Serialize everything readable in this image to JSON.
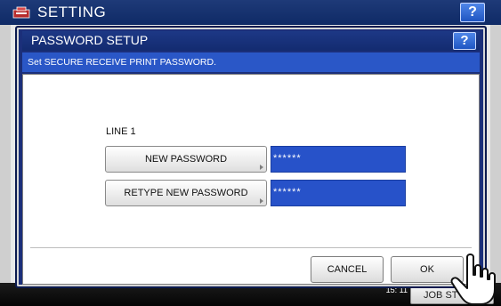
{
  "app": {
    "title": "SETTING",
    "help_label": "?"
  },
  "dialog": {
    "title": "PASSWORD SETUP",
    "help_label": "?",
    "message": "Set SECURE RECEIVE PRINT PASSWORD.",
    "line_label": "LINE 1",
    "new_password": {
      "label": "NEW PASSWORD",
      "value": "******"
    },
    "retype_password": {
      "label": "RETYPE NEW PASSWORD",
      "value": "******"
    },
    "cancel_label": "CANCEL",
    "ok_label": "OK"
  },
  "footer": {
    "time": "15: 11",
    "job_status_label": "JOB ST"
  },
  "colors": {
    "header_blue": "#1e3a78",
    "message_bar_blue": "#2a57c7",
    "value_field_blue": "#2752c9"
  }
}
